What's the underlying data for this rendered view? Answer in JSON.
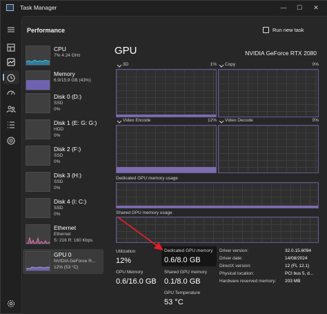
{
  "window": {
    "title": "Task Manager",
    "minimize_glyph": "—",
    "maximize_glyph": "☐",
    "close_glyph": "✕"
  },
  "header": {
    "page_title": "Performance",
    "run_new_task": "Run new task"
  },
  "nav_icons": [
    "hamburger-icon",
    "processes-icon",
    "performance-icon",
    "history-icon",
    "startup-icon",
    "users-icon",
    "details-icon",
    "services-icon",
    "settings-icon"
  ],
  "devices": [
    {
      "name": "CPU",
      "sub1": "7% 4.24 GHz",
      "sub2": ""
    },
    {
      "name": "Memory",
      "sub1": "6.9/15.9 GB (43%)",
      "sub2": ""
    },
    {
      "name": "Disk 0 (D:)",
      "sub1": "SSD",
      "sub2": "0%"
    },
    {
      "name": "Disk 1 (E: G: G:)",
      "sub1": "HDD",
      "sub2": "0%"
    },
    {
      "name": "Disk 2 (F:)",
      "sub1": "SSD",
      "sub2": "0%"
    },
    {
      "name": "Disk 3 (H:)",
      "sub1": "SSD",
      "sub2": "0%"
    },
    {
      "name": "Disk 4 (I: C:)",
      "sub1": "SSD",
      "sub2": "0%"
    },
    {
      "name": "Ethernet",
      "sub1": "Ethernet",
      "sub2": "S: 216 R: 160 Kbps"
    },
    {
      "name": "GPU 0",
      "sub1": "NVIDIA GeForce R...",
      "sub2": "12% (53 °C)"
    }
  ],
  "gpu": {
    "title": "GPU",
    "model": "NVIDIA GeForce RTX 2080",
    "engines": [
      {
        "label": "3D",
        "pct": "1%",
        "level": 0.04
      },
      {
        "label": "Copy",
        "pct": "0%",
        "level": 0.0
      },
      {
        "label": "Video Encode",
        "pct": "12%",
        "level": 0.12
      },
      {
        "label": "Video Decode",
        "pct": "0%",
        "level": 0.0
      }
    ],
    "dedicated_graph_label": "Dedicated GPU memory usage",
    "dedicated_level": 0.075,
    "shared_graph_label": "Shared GPU memory usage",
    "shared_level": 0.0125,
    "stats": {
      "utilization_label": "Utilization",
      "utilization_value": "12%",
      "dedicated_label": "Dedicated GPU memory",
      "dedicated_value": "0.6/8.0 GB",
      "gpu_memory_label": "GPU Memory",
      "gpu_memory_value": "0.6/16.0 GB",
      "shared_label": "Shared GPU memory",
      "shared_value": "0.1/8.0 GB",
      "temp_label": "GPU Temperature",
      "temp_value": "53 °C"
    },
    "info": [
      {
        "k": "Driver version:",
        "v": "32.0.15.6094"
      },
      {
        "k": "Driver date:",
        "v": "14/08/2024"
      },
      {
        "k": "DirectX version:",
        "v": "12 (FL 12.1)"
      },
      {
        "k": "Physical location:",
        "v": "PCI bus 5, d..."
      },
      {
        "k": "Hardware reserved memory:",
        "v": "203 MB"
      }
    ]
  },
  "colors": {
    "accent_purple": "#7d6cb0",
    "annotation_red": "#e0202a",
    "active_rail": "#8fb8e6"
  }
}
